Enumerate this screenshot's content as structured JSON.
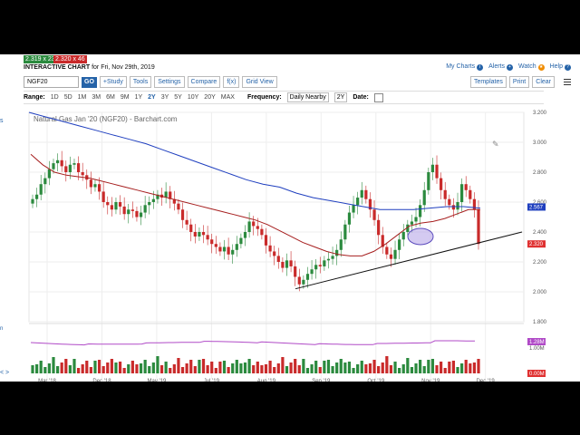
{
  "header": {
    "bid": "2.319 x 23",
    "ask": "2.320 x 46",
    "title_bold": "INTERACTIVE CHART",
    "title_rest": "for Fri, Nov 29th, 2019",
    "links": [
      "My Charts",
      "Alerts",
      "Watch",
      "Help"
    ]
  },
  "toolbar": {
    "symbol": "NGF20",
    "go": "GO",
    "buttons": [
      "+Study",
      "Tools",
      "Settings",
      "Compare",
      "f(x)",
      "Grid View"
    ],
    "right_buttons": [
      "Templates",
      "Print",
      "Clear"
    ]
  },
  "range": {
    "label": "Range:",
    "options": [
      "1D",
      "5D",
      "1M",
      "3M",
      "6M",
      "9M",
      "1Y",
      "2Y",
      "3Y",
      "5Y",
      "10Y",
      "20Y",
      "MAX"
    ],
    "selected": "2Y",
    "frequency_label": "Frequency:",
    "frequency": "Daily Nearby",
    "period": "2Y",
    "date_label": "Date:"
  },
  "chart_data": {
    "type": "candlestick",
    "title": "Natural Gas Jan '20 (NGF20) - Barchart.com",
    "y_ticks": [
      "3.200",
      "3.000",
      "2.800",
      "2.600",
      "2.400",
      "2.200",
      "2.000",
      "1.800"
    ],
    "ylim": [
      1.8,
      3.2
    ],
    "x_ticks": [
      "Mar '18",
      "Dec '18",
      "May '19",
      "Jul '19",
      "Aug '19",
      "Sep '19",
      "Oct '19",
      "Nov '19",
      "Dec '19"
    ],
    "price_labels": [
      {
        "text": "2.567",
        "color": "#1f3fbf",
        "value": 2.567
      },
      {
        "text": "2.320",
        "color": "#e03131",
        "value": 2.32
      }
    ],
    "volume_labels": [
      "1.28M",
      "1.00M",
      "0.00M"
    ],
    "close": [
      2.62,
      2.65,
      2.72,
      2.76,
      2.82,
      2.86,
      2.88,
      2.84,
      2.8,
      2.85,
      2.86,
      2.8,
      2.78,
      2.75,
      2.7,
      2.72,
      2.67,
      2.6,
      2.58,
      2.55,
      2.6,
      2.57,
      2.52,
      2.55,
      2.54,
      2.5,
      2.53,
      2.58,
      2.6,
      2.62,
      2.65,
      2.63,
      2.67,
      2.62,
      2.59,
      2.55,
      2.48,
      2.45,
      2.4,
      2.37,
      2.4,
      2.38,
      2.35,
      2.32,
      2.3,
      2.27,
      2.3,
      2.25,
      2.28,
      2.32,
      2.36,
      2.4,
      2.47,
      2.44,
      2.42,
      2.38,
      2.31,
      2.27,
      2.24,
      2.2,
      2.16,
      2.21,
      2.17,
      2.1,
      2.05,
      2.08,
      2.12,
      2.15,
      2.18,
      2.17,
      2.21,
      2.22,
      2.24,
      2.28,
      2.35,
      2.45,
      2.53,
      2.58,
      2.63,
      2.68,
      2.62,
      2.55,
      2.48,
      2.38,
      2.3,
      2.25,
      2.22,
      2.28,
      2.35,
      2.4,
      2.45,
      2.47,
      2.5,
      2.58,
      2.68,
      2.8,
      2.85,
      2.76,
      2.68,
      2.62,
      2.58,
      2.55,
      2.6,
      2.72,
      2.68,
      2.62,
      2.55,
      2.32
    ],
    "ma_red": [
      2.92,
      2.85,
      2.8,
      2.78,
      2.77,
      2.76,
      2.74,
      2.72,
      2.7,
      2.68,
      2.66,
      2.64,
      2.62,
      2.6,
      2.58,
      2.56,
      2.54,
      2.52,
      2.5,
      2.48,
      2.45,
      2.41,
      2.37,
      2.33,
      2.3,
      2.27,
      2.25,
      2.24,
      2.24,
      2.27,
      2.32,
      2.38,
      2.44,
      2.46,
      2.47,
      2.49,
      2.52,
      2.55,
      2.55
    ],
    "ma_blue": [
      3.2,
      3.17,
      3.14,
      3.11,
      3.08,
      3.05,
      3.02,
      2.99,
      2.95,
      2.91,
      2.87,
      2.83,
      2.79,
      2.75,
      2.72,
      2.7,
      2.66,
      2.63,
      2.61,
      2.59,
      2.57,
      2.55,
      2.55,
      2.55,
      2.56,
      2.57,
      2.57,
      2.56
    ],
    "trendline": [
      2.02,
      2.4
    ],
    "annotation": "ellipse"
  },
  "left_tabs": [
    "s",
    "n"
  ],
  "bottom_links": [
    "< >"
  ]
}
